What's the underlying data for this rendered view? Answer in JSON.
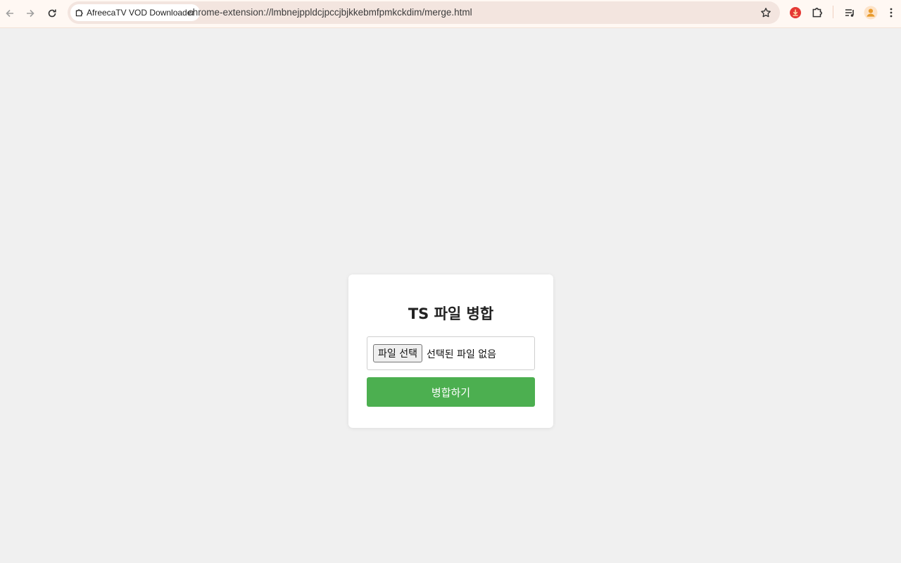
{
  "browser": {
    "site_chip_label": "AfreecaTV VOD Downloader",
    "url": "chrome-extension://lmbnejppldcjpccjbjkkebmfpmkckdim/merge.html",
    "icons": [
      "back-arrow-icon",
      "forward-arrow-icon",
      "reload-icon",
      "extension-puzzle-icon",
      "star-bookmark-icon",
      "extension-red-icon",
      "media-control-icon",
      "profile-avatar-icon",
      "more-vertical-icon"
    ],
    "colors": {
      "toolbar_bg": "#fff8f3",
      "omnibox_bg": "#f3e5df",
      "avatar": "#e89a2c"
    }
  },
  "merge_page": {
    "title": "TS 파일 병합",
    "file_button_label": "파일 선택",
    "file_status": "선택된 파일 없음",
    "merge_button_label": "병합하기",
    "colors": {
      "page_bg": "#f0f0f0",
      "card_bg": "#ffffff",
      "merge_button": "#4caf50"
    }
  }
}
